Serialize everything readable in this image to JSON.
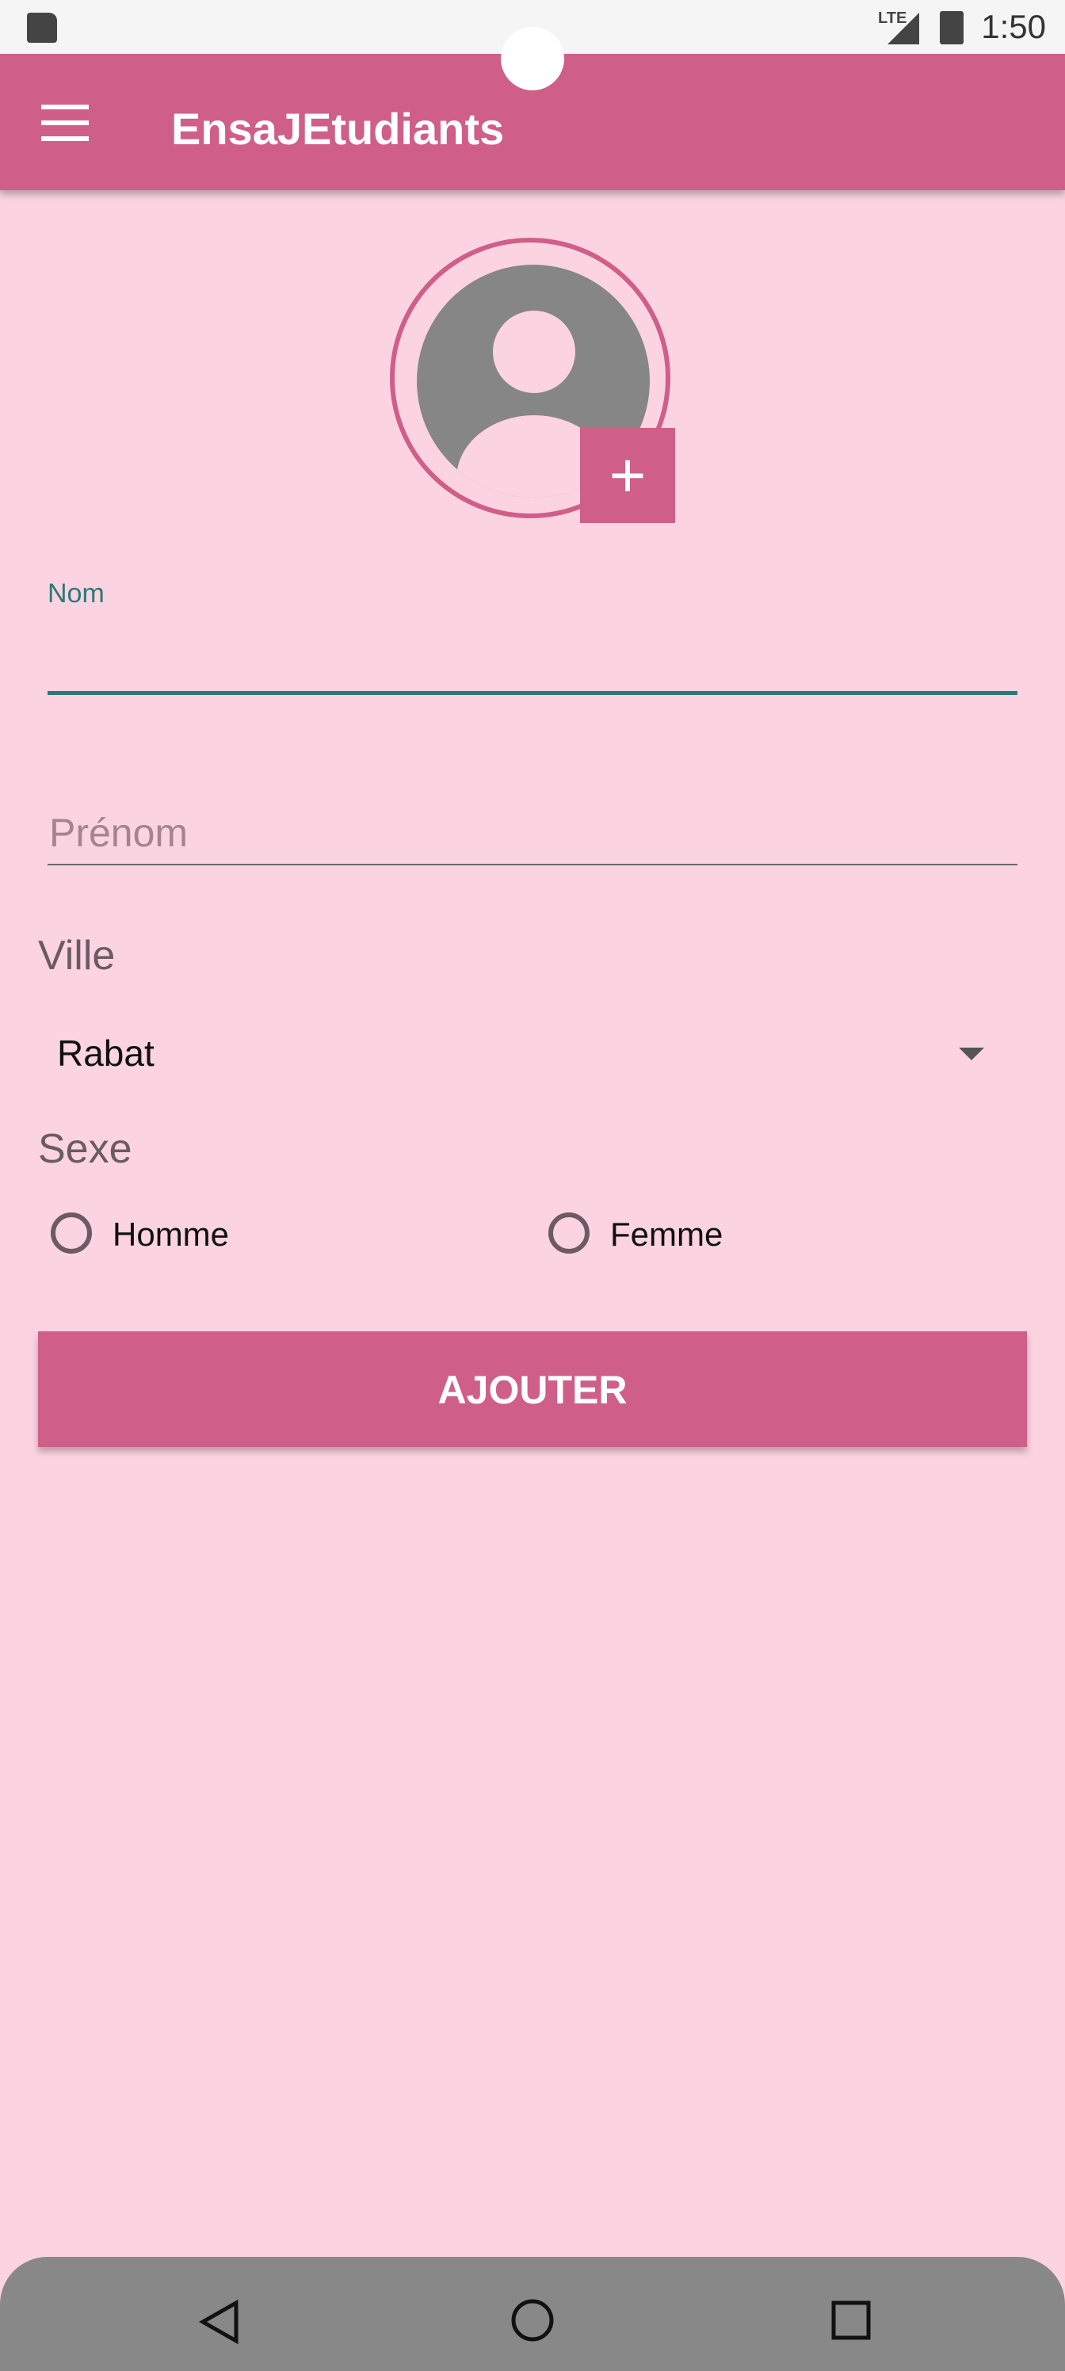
{
  "status_bar": {
    "time": "1:50",
    "network": "LTE"
  },
  "app_bar": {
    "title": "EnsaJEtudiants"
  },
  "form": {
    "nom": {
      "label": "Nom",
      "value": ""
    },
    "prenom": {
      "placeholder": "Prénom",
      "value": ""
    },
    "ville": {
      "label": "Ville",
      "selected": "Rabat"
    },
    "sexe": {
      "label": "Sexe",
      "options": [
        "Homme",
        "Femme"
      ]
    },
    "submit_label": "AJOUTER",
    "add_photo_symbol": "+"
  },
  "colors": {
    "primary": "#cf5f88",
    "background": "#fcd3e1",
    "accent": "#2b7a78"
  }
}
